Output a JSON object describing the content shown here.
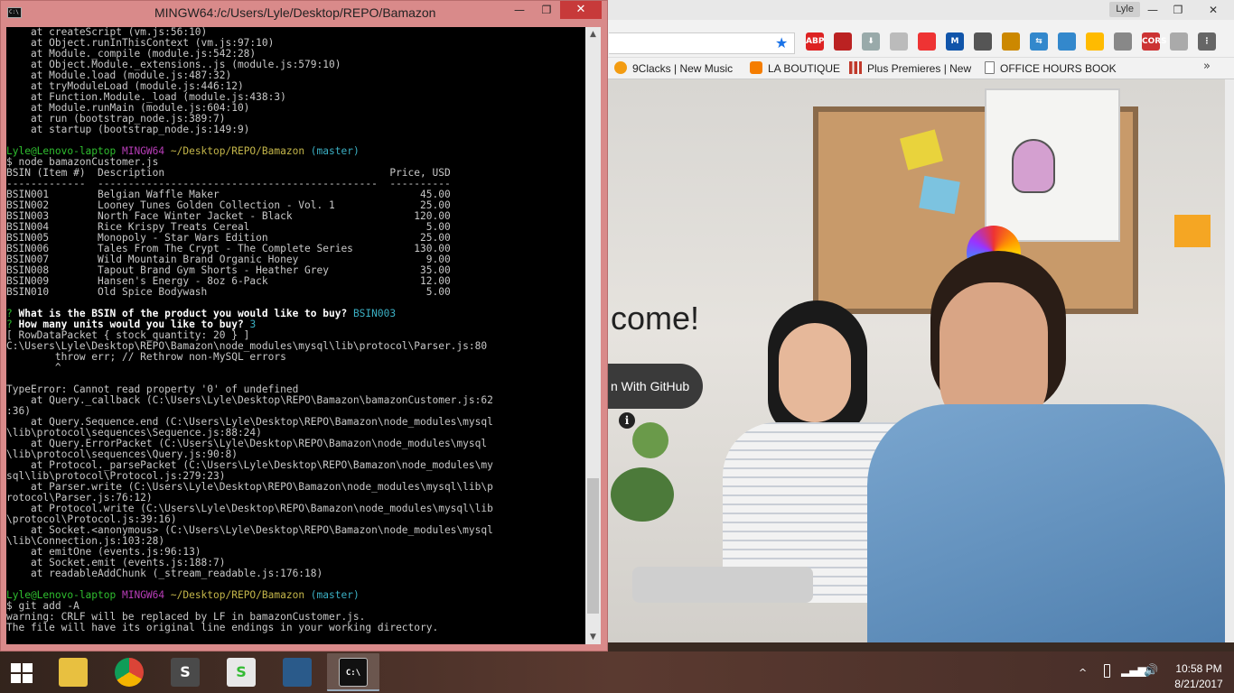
{
  "browser": {
    "profile_name": "Lyle",
    "window_controls": {
      "minimize": "—",
      "maximize": "❐",
      "close": "✕"
    },
    "bookmarks": [
      {
        "label": "9Clacks | New Music",
        "icon": "9clacks-icon",
        "color": "#f39c12"
      },
      {
        "label": "LA BOUTIQUE",
        "icon": "blogger-icon",
        "color": "#f57d00"
      },
      {
        "label": "Plus Premieres | New",
        "icon": "bars-icon",
        "color": "#c0392b"
      },
      {
        "label": "OFFICE HOURS BOOK",
        "icon": "document-icon",
        "color": "#ffffff"
      }
    ],
    "bookmarks_more": "»",
    "extensions": [
      {
        "name": "adblock-icon",
        "label": "ABP",
        "color": "#d22"
      },
      {
        "name": "spy-icon",
        "label": "",
        "color": "#b22"
      },
      {
        "name": "download-icon",
        "label": "⬇",
        "color": "#9aa"
      },
      {
        "name": "pdf-icon",
        "label": "",
        "color": "#bbb"
      },
      {
        "name": "shield-icon",
        "label": "",
        "color": "#e33"
      },
      {
        "name": "m-icon",
        "label": "M",
        "color": "#15a"
      },
      {
        "name": "eyedropper-icon",
        "label": "",
        "color": "#555"
      },
      {
        "name": "hammer-icon",
        "label": "",
        "color": "#c80"
      },
      {
        "name": "arrows-icon",
        "label": "⇆",
        "color": "#38c"
      },
      {
        "name": "screenshot-icon",
        "label": "",
        "color": "#38c"
      },
      {
        "name": "bulb-icon",
        "label": "",
        "color": "#fb0"
      },
      {
        "name": "code-icon",
        "label": "",
        "color": "#888"
      },
      {
        "name": "cors-icon",
        "label": "CORS",
        "color": "#c33"
      },
      {
        "name": "cast-icon",
        "label": "",
        "color": "#aaa"
      },
      {
        "name": "menu-icon",
        "label": "⋮",
        "color": "#666"
      }
    ],
    "page": {
      "welcome_text": "come!",
      "github_button": "n With GitHub",
      "info_icon": "i"
    }
  },
  "terminal": {
    "title": "MINGW64:/c/Users/Lyle/Desktop/REPO/Bamazon",
    "window_controls": {
      "minimize": "—",
      "maximize": "❐",
      "close": "✕"
    },
    "lines": [
      [
        {
          "t": "    at createScript (vm.js:56:10)",
          "c": ""
        }
      ],
      [
        {
          "t": "    at Object.runInThisContext (vm.js:97:10)",
          "c": ""
        }
      ],
      [
        {
          "t": "    at Module._compile (module.js:542:28)",
          "c": ""
        }
      ],
      [
        {
          "t": "    at Object.Module._extensions..js (module.js:579:10)",
          "c": ""
        }
      ],
      [
        {
          "t": "    at Module.load (module.js:487:32)",
          "c": ""
        }
      ],
      [
        {
          "t": "    at tryModuleLoad (module.js:446:12)",
          "c": ""
        }
      ],
      [
        {
          "t": "    at Function.Module._load (module.js:438:3)",
          "c": ""
        }
      ],
      [
        {
          "t": "    at Module.runMain (module.js:604:10)",
          "c": ""
        }
      ],
      [
        {
          "t": "    at run (bootstrap_node.js:389:7)",
          "c": ""
        }
      ],
      [
        {
          "t": "    at startup (bootstrap_node.js:149:9)",
          "c": ""
        }
      ],
      [
        {
          "t": "",
          "c": ""
        }
      ],
      [
        {
          "t": "Lyle@Lenovo-laptop ",
          "c": "c-green"
        },
        {
          "t": "MINGW64 ",
          "c": "c-purple"
        },
        {
          "t": "~/Desktop/REPO/Bamazon ",
          "c": "c-yellow"
        },
        {
          "t": "(master)",
          "c": "c-cyan"
        }
      ],
      [
        {
          "t": "$ node bamazonCustomer.js",
          "c": ""
        }
      ],
      [
        {
          "t": "BSIN (Item #)  Description                                     Price, USD",
          "c": ""
        }
      ],
      [
        {
          "t": "-------------  ----------------------------------------------  ----------",
          "c": ""
        }
      ],
      [
        {
          "t": "BSIN001        Belgian Waffle Maker                                 45.00",
          "c": ""
        }
      ],
      [
        {
          "t": "BSIN002        Looney Tunes Golden Collection - Vol. 1              25.00",
          "c": ""
        }
      ],
      [
        {
          "t": "BSIN003        North Face Winter Jacket - Black                    120.00",
          "c": ""
        }
      ],
      [
        {
          "t": "BSIN004        Rice Krispy Treats Cereal                             5.00",
          "c": ""
        }
      ],
      [
        {
          "t": "BSIN005        Monopoly - Star Wars Edition                         25.00",
          "c": ""
        }
      ],
      [
        {
          "t": "BSIN006        Tales From The Crypt - The Complete Series          130.00",
          "c": ""
        }
      ],
      [
        {
          "t": "BSIN007        Wild Mountain Brand Organic Honey                     9.00",
          "c": ""
        }
      ],
      [
        {
          "t": "BSIN008        Tapout Brand Gym Shorts - Heather Grey               35.00",
          "c": ""
        }
      ],
      [
        {
          "t": "BSIN009        Hansen's Energy - 8oz 6-Pack                         12.00",
          "c": ""
        }
      ],
      [
        {
          "t": "BSIN010        Old Spice Bodywash                                    5.00",
          "c": ""
        }
      ],
      [
        {
          "t": "",
          "c": ""
        }
      ],
      [
        {
          "t": "? ",
          "c": "c-green"
        },
        {
          "t": "What is the BSIN of the product you would like to buy? ",
          "c": "c-bold"
        },
        {
          "t": "BSIN003",
          "c": "c-cyan"
        }
      ],
      [
        {
          "t": "? ",
          "c": "c-green"
        },
        {
          "t": "How many units would you like to buy? ",
          "c": "c-bold"
        },
        {
          "t": "3",
          "c": "c-cyan"
        }
      ],
      [
        {
          "t": "[ RowDataPacket { stock_quantity: 20 } ]",
          "c": ""
        }
      ],
      [
        {
          "t": "C:\\Users\\Lyle\\Desktop\\REPO\\Bamazon\\node_modules\\mysql\\lib\\protocol\\Parser.js:80",
          "c": ""
        }
      ],
      [
        {
          "t": "        throw err; // Rethrow non-MySQL errors",
          "c": ""
        }
      ],
      [
        {
          "t": "        ^",
          "c": ""
        }
      ],
      [
        {
          "t": "",
          "c": ""
        }
      ],
      [
        {
          "t": "TypeError: Cannot read property '0' of undefined",
          "c": ""
        }
      ],
      [
        {
          "t": "    at Query._callback (C:\\Users\\Lyle\\Desktop\\REPO\\Bamazon\\bamazonCustomer.js:62",
          "c": ""
        }
      ],
      [
        {
          "t": ":36)",
          "c": ""
        }
      ],
      [
        {
          "t": "    at Query.Sequence.end (C:\\Users\\Lyle\\Desktop\\REPO\\Bamazon\\node_modules\\mysql",
          "c": ""
        }
      ],
      [
        {
          "t": "\\lib\\protocol\\sequences\\Sequence.js:88:24)",
          "c": ""
        }
      ],
      [
        {
          "t": "    at Query.ErrorPacket (C:\\Users\\Lyle\\Desktop\\REPO\\Bamazon\\node_modules\\mysql",
          "c": ""
        }
      ],
      [
        {
          "t": "\\lib\\protocol\\sequences\\Query.js:90:8)",
          "c": ""
        }
      ],
      [
        {
          "t": "    at Protocol._parsePacket (C:\\Users\\Lyle\\Desktop\\REPO\\Bamazon\\node_modules\\my",
          "c": ""
        }
      ],
      [
        {
          "t": "sql\\lib\\protocol\\Protocol.js:279:23)",
          "c": ""
        }
      ],
      [
        {
          "t": "    at Parser.write (C:\\Users\\Lyle\\Desktop\\REPO\\Bamazon\\node_modules\\mysql\\lib\\p",
          "c": ""
        }
      ],
      [
        {
          "t": "rotocol\\Parser.js:76:12)",
          "c": ""
        }
      ],
      [
        {
          "t": "    at Protocol.write (C:\\Users\\Lyle\\Desktop\\REPO\\Bamazon\\node_modules\\mysql\\lib",
          "c": ""
        }
      ],
      [
        {
          "t": "\\protocol\\Protocol.js:39:16)",
          "c": ""
        }
      ],
      [
        {
          "t": "    at Socket.<anonymous> (C:\\Users\\Lyle\\Desktop\\REPO\\Bamazon\\node_modules\\mysql",
          "c": ""
        }
      ],
      [
        {
          "t": "\\lib\\Connection.js:103:28)",
          "c": ""
        }
      ],
      [
        {
          "t": "    at emitOne (events.js:96:13)",
          "c": ""
        }
      ],
      [
        {
          "t": "    at Socket.emit (events.js:188:7)",
          "c": ""
        }
      ],
      [
        {
          "t": "    at readableAddChunk (_stream_readable.js:176:18)",
          "c": ""
        }
      ],
      [
        {
          "t": "",
          "c": ""
        }
      ],
      [
        {
          "t": "Lyle@Lenovo-laptop ",
          "c": "c-green"
        },
        {
          "t": "MINGW64 ",
          "c": "c-purple"
        },
        {
          "t": "~/Desktop/REPO/Bamazon ",
          "c": "c-yellow"
        },
        {
          "t": "(master)",
          "c": "c-cyan"
        }
      ],
      [
        {
          "t": "$ git add -A",
          "c": ""
        }
      ],
      [
        {
          "t": "warning: CRLF will be replaced by LF in bamazonCustomer.js.",
          "c": ""
        }
      ],
      [
        {
          "t": "The file will have its original line endings in your working directory.",
          "c": ""
        }
      ]
    ]
  },
  "taskbar": {
    "apps": [
      {
        "name": "file-explorer-icon",
        "label": "",
        "color": "#e8c040",
        "active": false
      },
      {
        "name": "chrome-icon",
        "label": "",
        "color": "#db4437",
        "active": false
      },
      {
        "name": "sublime-text-icon",
        "label": "S",
        "color": "#4a4a4a",
        "active": false
      },
      {
        "name": "slack-icon",
        "label": "S",
        "color": "#e8e8e8",
        "active": false
      },
      {
        "name": "mysql-workbench-icon",
        "label": "",
        "color": "#2a5a8a",
        "active": false
      },
      {
        "name": "terminal-icon",
        "label": "C:\\",
        "color": "#111111",
        "active": true
      }
    ],
    "tray": {
      "up_arrow": "^",
      "clock_time": "10:58 PM",
      "clock_date": "8/21/2017"
    }
  }
}
